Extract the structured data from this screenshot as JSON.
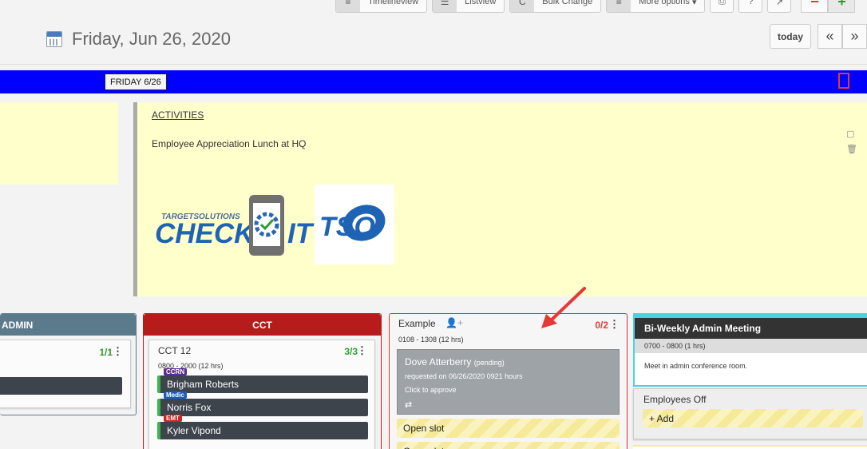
{
  "toolbar": {
    "timeline_label": "Timelineview",
    "list_label": "Listview",
    "bulk_label": "Bulk Change",
    "more_label": "More options",
    "print_icon": "print-icon",
    "help_icon": "help-icon",
    "expand_icon": "expand-icon",
    "zoom_out": "−",
    "zoom_in": "+"
  },
  "header": {
    "date_title": "Friday, Jun 26, 2020",
    "today_label": "today",
    "prev_label": "«",
    "next_label": "»"
  },
  "daybar": {
    "label": "FRIDAY 6/26",
    "color": "#0000ff"
  },
  "activities": {
    "heading": "ACTIVITIES",
    "text": "Employee Appreciation Lunch at HQ",
    "logo_small": "TARGETSOLUTIONS",
    "logo_big_left": "CHECK",
    "logo_big_right": "IT",
    "logo_tso": "TSO"
  },
  "columns": {
    "admin": {
      "title": "ADMIN",
      "count": "1/1"
    },
    "cct": {
      "title": "CCT",
      "shift_title": "CCT 12",
      "count": "3/3",
      "hours": "0800 - 2000 (12 hrs)",
      "people": [
        {
          "name": "Brigham Roberts",
          "tag": "CCRN"
        },
        {
          "name": "Norris Fox",
          "tag": "Medic"
        },
        {
          "name": "Kyler Vipond",
          "tag": "EMT"
        }
      ]
    },
    "example": {
      "title": "Example",
      "count": "0/2",
      "hours": "0108 - 1308 (12 hrs)",
      "pending_name": "Dove Atterberry",
      "pending_status": "(pending)",
      "requested": "requested on 06/26/2020 0921 hours",
      "approve": "Click to approve",
      "open_slot": "Open slot",
      "second_slot": "Open slot"
    },
    "meeting": {
      "title": "Bi-Weekly Admin Meeting",
      "time": "0700 - 0800 (1 hrs)",
      "desc": "Meet in admin conference room.",
      "off_title": "Employees Off",
      "add_label": "+ Add"
    }
  }
}
